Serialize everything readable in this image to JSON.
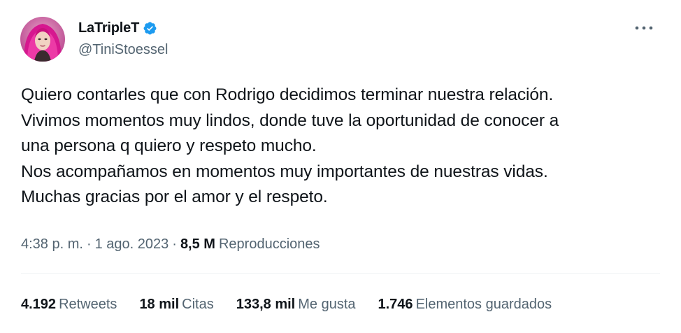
{
  "author": {
    "display_name": "LaTripleT",
    "handle": "@TiniStoessel",
    "verified": true,
    "avatar_icon": "avatar-photo-pink-hair"
  },
  "menu": {
    "icon": "more-horizontal-icon"
  },
  "tweet": {
    "lines": [
      "Quiero contarles que con Rodrigo decidimos terminar nuestra relación.",
      "Vivimos momentos muy lindos, donde tuve la oportunidad de conocer a",
      "una persona q quiero y respeto mucho.",
      "Nos acompañamos en momentos muy importantes de nuestras vidas.",
      "Muchas gracias por el amor y el respeto."
    ]
  },
  "meta": {
    "time": "4:38 p. m.",
    "separator": "·",
    "date": "1 ago. 2023",
    "views_count": "8,5 M",
    "views_label": "Reproducciones"
  },
  "stats": {
    "retweets": {
      "count": "4.192",
      "label": "Retweets"
    },
    "quotes": {
      "count": "18 mil",
      "label": "Citas"
    },
    "likes": {
      "count": "133,8 mil",
      "label": "Me gusta"
    },
    "bookmarks": {
      "count": "1.746",
      "label": "Elementos guardados"
    }
  },
  "colors": {
    "text_primary": "#0f1419",
    "text_secondary": "#536471",
    "verified_blue": "#1d9bf0",
    "divider": "#eff3f4"
  }
}
